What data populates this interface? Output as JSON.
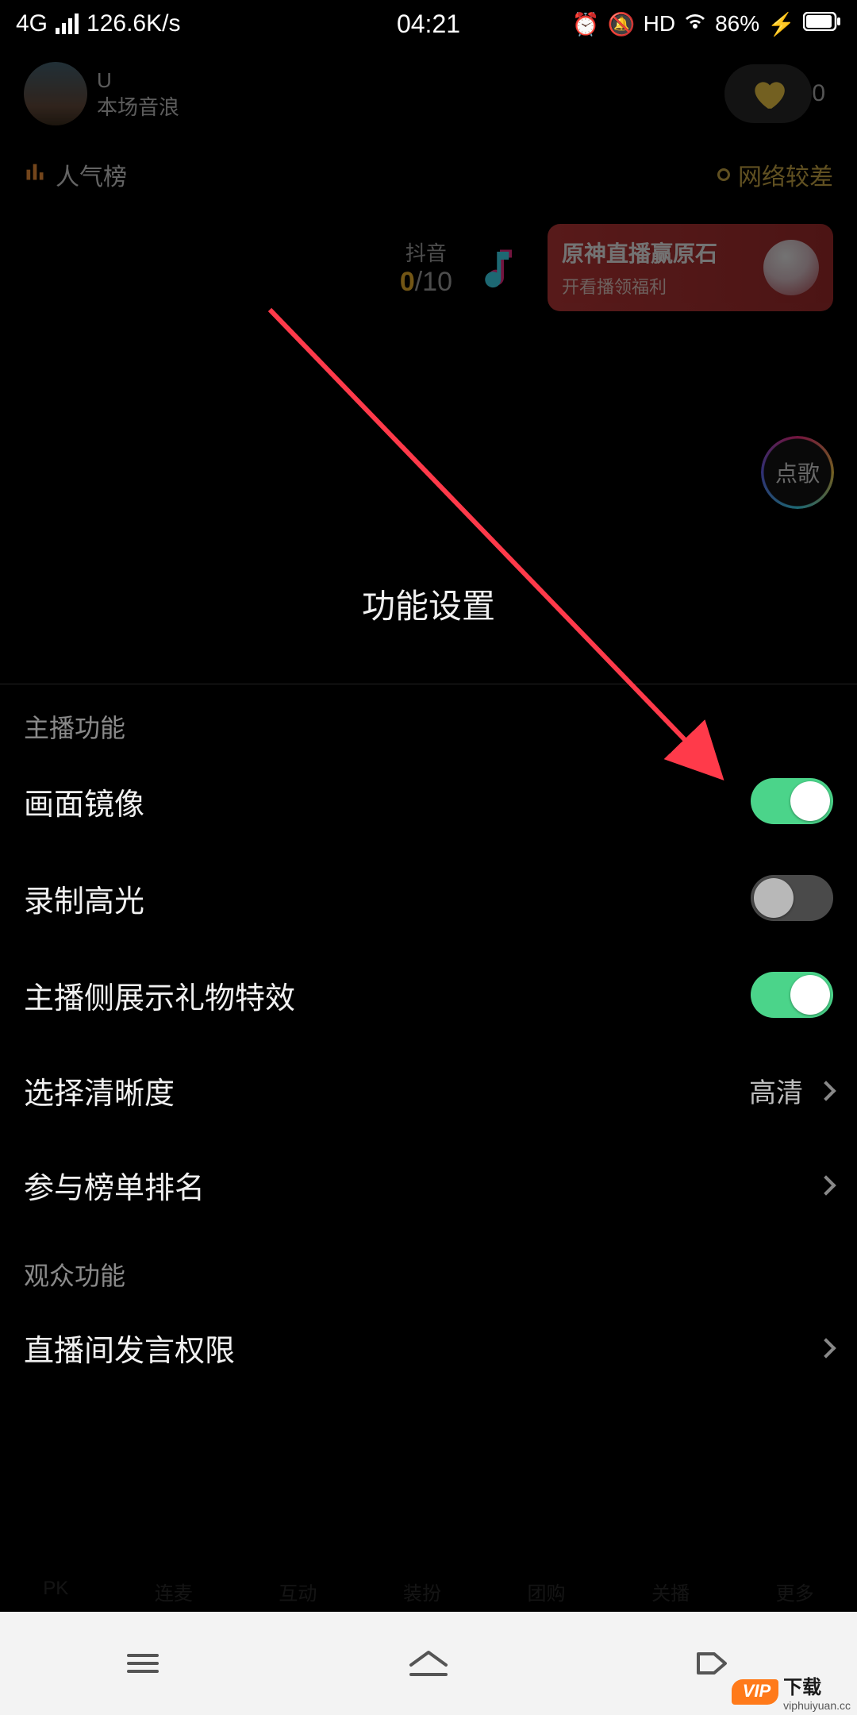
{
  "status": {
    "network": "4G",
    "speed": "126.6K/s",
    "time": "04:21",
    "hd": "HD",
    "battery": "86%"
  },
  "bg": {
    "name_line1": "U",
    "name_line2": "本场音浪",
    "viewer_count": "0",
    "rank_label": "人气榜",
    "net_status": "网络较差",
    "douyin_label": "抖音",
    "douyin_current": "0",
    "douyin_total": "/10",
    "promo_title": "原神直播赢原石",
    "promo_sub": "开看播领福利",
    "song_request": "点歌"
  },
  "panel": {
    "title": "功能设置",
    "section_host": "主播功能",
    "section_audience": "观众功能",
    "items": {
      "mirror": {
        "label": "画面镜像",
        "on": true
      },
      "highlight": {
        "label": "录制高光",
        "on": false
      },
      "gift_effect": {
        "label": "主播侧展示礼物特效",
        "on": true
      },
      "resolution": {
        "label": "选择清晰度",
        "value": "高清"
      },
      "ranking": {
        "label": "参与榜单排名"
      },
      "speak_permission": {
        "label": "直播间发言权限"
      }
    }
  },
  "watermark": {
    "badge": "VIP",
    "text": "下载",
    "url": "viphuiyuan.cc"
  }
}
